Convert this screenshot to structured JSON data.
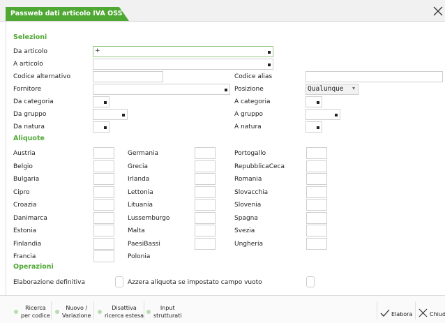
{
  "window": {
    "title": "Passweb dati articolo IVA OSS"
  },
  "sections": {
    "selezioni": "Selezioni",
    "aliquote": "Aliquote",
    "operazioni": "Operazioni"
  },
  "fields": {
    "da_articolo": {
      "label": "Da articolo",
      "value": "+"
    },
    "a_articolo": {
      "label": "A articolo",
      "value": ""
    },
    "codice_alternativo": {
      "label": "Codice alternativo",
      "value": ""
    },
    "codice_alias": {
      "label": "Codice alias",
      "value": ""
    },
    "fornitore": {
      "label": "Fornitore",
      "value": ""
    },
    "posizione": {
      "label": "Posizione",
      "value": "Qualunque"
    },
    "da_categoria": {
      "label": "Da categoria",
      "value": ""
    },
    "a_categoria": {
      "label": "A categoria",
      "value": ""
    },
    "da_gruppo": {
      "label": "Da gruppo",
      "value": ""
    },
    "a_gruppo": {
      "label": "A gruppo",
      "value": ""
    },
    "da_natura": {
      "label": "Da natura",
      "value": ""
    },
    "a_natura": {
      "label": "A natura",
      "value": ""
    }
  },
  "aliquote": {
    "col1": [
      "Austria",
      "Belgio",
      "Bulgaria",
      "Cipro",
      "Croazia",
      "Danimarca",
      "Estonia",
      "Finlandia",
      "Francia"
    ],
    "col2": [
      "Germania",
      "Grecia",
      "Irlanda",
      "Lettonia",
      "Lituania",
      "Lussemburgo",
      "Malta",
      "PaesiBassi",
      "Polonia"
    ],
    "col3": [
      "Portogallo",
      "RepubblicaCeca",
      "Romania",
      "Slovacchia",
      "Slovenia",
      "Spagna",
      "Svezia",
      "Ungheria"
    ]
  },
  "operazioni": {
    "elaborazione_definitiva": "Elaborazione definitiva",
    "azzera_aliquota": "Azzera aliquota se impostato campo vuoto"
  },
  "footer": {
    "buttons": [
      {
        "line1": "Ricerca",
        "line2": "per codice"
      },
      {
        "line1": "Nuovo /",
        "line2": "Variazione"
      },
      {
        "line1": "Disattiva",
        "line2": "ricerca estesa"
      },
      {
        "line1": "Input",
        "line2": "strutturati"
      }
    ],
    "elabora": "Elabora",
    "chiudi": "Chiud"
  },
  "colors": {
    "accent": "#4fa734",
    "border": "#cfcfcf"
  },
  "icons": {
    "close": "close-x-icon",
    "check": "check-icon",
    "dot": "dot-icon"
  }
}
